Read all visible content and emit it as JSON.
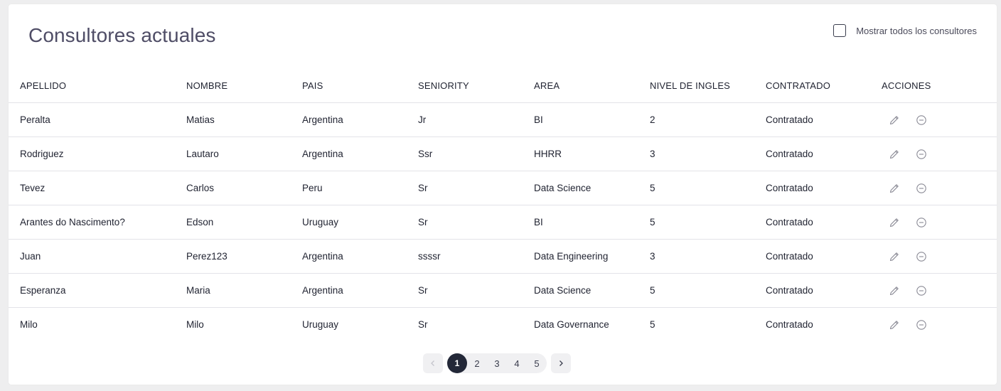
{
  "header": {
    "title": "Consultores actuales",
    "show_all_label": "Mostrar todos los consultores"
  },
  "table": {
    "columns": [
      "APELLIDO",
      "NOMBRE",
      "PAIS",
      "SENIORITY",
      "AREA",
      "NIVEL DE INGLES",
      "CONTRATADO",
      "ACCIONES"
    ],
    "rows": [
      {
        "apellido": "Peralta",
        "nombre": "Matias",
        "pais": "Argentina",
        "seniority": "Jr",
        "area": "BI",
        "nivel": "2",
        "contratado": "Contratado"
      },
      {
        "apellido": "Rodriguez",
        "nombre": "Lautaro",
        "pais": "Argentina",
        "seniority": "Ssr",
        "area": "HHRR",
        "nivel": "3",
        "contratado": "Contratado"
      },
      {
        "apellido": "Tevez",
        "nombre": "Carlos",
        "pais": "Peru",
        "seniority": "Sr",
        "area": "Data Science",
        "nivel": "5",
        "contratado": "Contratado"
      },
      {
        "apellido": "Arantes do Nascimento?",
        "nombre": "Edson",
        "pais": "Uruguay",
        "seniority": "Sr",
        "area": "BI",
        "nivel": "5",
        "contratado": "Contratado"
      },
      {
        "apellido": "Juan",
        "nombre": "Perez123",
        "pais": "Argentina",
        "seniority": "ssssr",
        "area": "Data Engineering",
        "nivel": "3",
        "contratado": "Contratado"
      },
      {
        "apellido": "Esperanza",
        "nombre": "Maria",
        "pais": "Argentina",
        "seniority": "Sr",
        "area": "Data Science",
        "nivel": "5",
        "contratado": "Contratado"
      },
      {
        "apellido": "Milo",
        "nombre": "Milo",
        "pais": "Uruguay",
        "seniority": "Sr",
        "area": "Data Governance",
        "nivel": "5",
        "contratado": "Contratado"
      }
    ],
    "row_actions": [
      "pencil-icon",
      "minus-circle-icon"
    ]
  },
  "pagination": {
    "pages": [
      "1",
      "2",
      "3",
      "4",
      "5"
    ],
    "current": "1",
    "prev_icon": "chevron-left-icon",
    "next_icon": "chevron-right-icon"
  },
  "colors": {
    "title": "#4f4d66",
    "active_page": "#232838",
    "icon": "#8a8a95"
  }
}
